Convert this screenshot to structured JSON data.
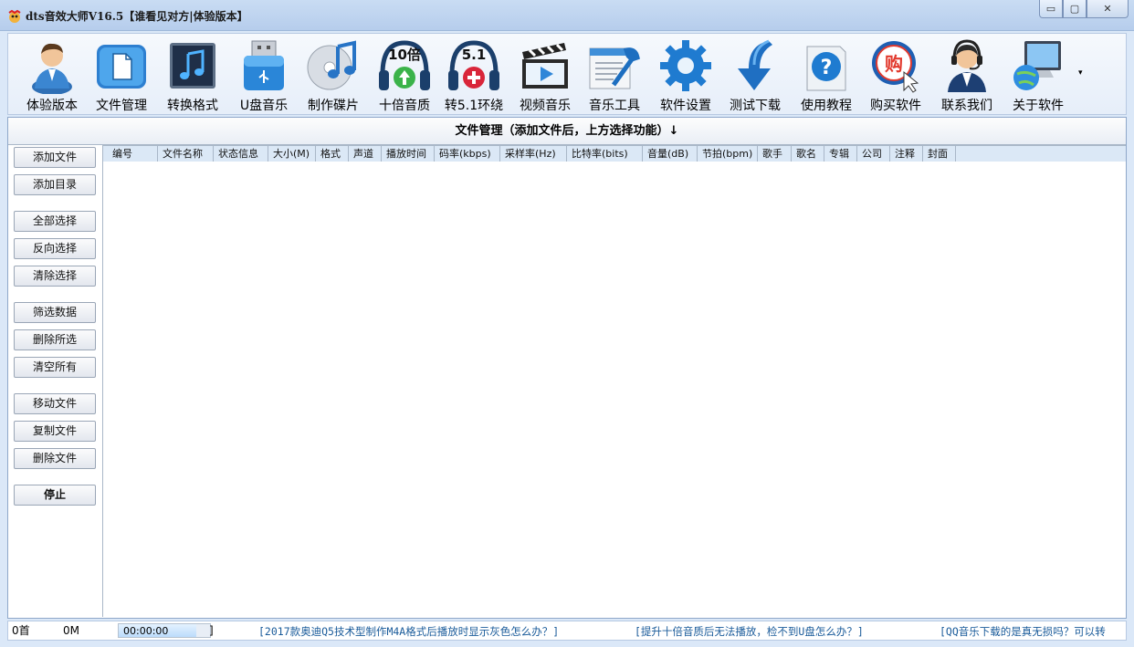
{
  "window": {
    "title": "dts音效大师V16.5【谁看见对方|体验版本】",
    "minimize": "▭",
    "maximize": "▢",
    "close": "✕"
  },
  "toolbar": {
    "items": [
      {
        "label": "体验版本",
        "icon": "user-icon"
      },
      {
        "label": "文件管理",
        "icon": "file-icon"
      },
      {
        "label": "转换格式",
        "icon": "music-note-icon"
      },
      {
        "label": "U盘音乐",
        "icon": "usb-icon"
      },
      {
        "label": "制作碟片",
        "icon": "disc-icon"
      },
      {
        "label": "十倍音质",
        "icon": "headphones-10x-icon",
        "badge": "10倍"
      },
      {
        "label": "转5.1环绕",
        "icon": "headphones-51-icon",
        "badge": "5.1"
      },
      {
        "label": "视频音乐",
        "icon": "clapper-icon"
      },
      {
        "label": "音乐工具",
        "icon": "tools-icon"
      },
      {
        "label": "软件设置",
        "icon": "gear-icon"
      },
      {
        "label": "测试下载",
        "icon": "download-arrow-icon"
      },
      {
        "label": "使用教程",
        "icon": "help-icon"
      },
      {
        "label": "购买软件",
        "icon": "buy-icon",
        "badge": "购"
      },
      {
        "label": "联系我们",
        "icon": "support-agent-icon"
      },
      {
        "label": "关于软件",
        "icon": "computer-globe-icon"
      }
    ],
    "more": "▾"
  },
  "section": {
    "title": "文件管理（添加文件后，上方选择功能）↓"
  },
  "sidebar": {
    "buttons": [
      {
        "label": "添加文件"
      },
      {
        "label": "添加目录"
      },
      {
        "label": "全部选择"
      },
      {
        "label": "反向选择"
      },
      {
        "label": "清除选择"
      },
      {
        "label": "筛选数据"
      },
      {
        "label": "删除所选"
      },
      {
        "label": "清空所有"
      },
      {
        "label": "移动文件"
      },
      {
        "label": "复制文件"
      },
      {
        "label": "删除文件"
      },
      {
        "label": "停止"
      }
    ]
  },
  "table": {
    "columns": [
      "编号",
      "文件名称",
      "状态信息",
      "大小(M)",
      "格式",
      "声道",
      "播放时间",
      "码率(kbps)",
      "采样率(Hz)",
      "比特率(bits)",
      "音量(dB)",
      "节拍(bpm)",
      "歌手",
      "歌名",
      "专辑",
      "公司",
      "注释",
      "封面"
    ],
    "rows": []
  },
  "status": {
    "count": "0首",
    "size": "0M",
    "time": "00:00:00",
    "progress": 0.85,
    "progress_end": "]",
    "tip1": "[2017款奥迪Q5技术型制作M4A格式后播放时显示灰色怎么办？]",
    "tip2": "[提升十倍音质后无法播放，检不到U盘怎么办？]",
    "tip3": "[QQ音乐下载的是真无损吗？可以转"
  },
  "colors": {
    "accent": "#1a5b9a",
    "header_bg": "#dbe8f6",
    "window_bg": "#dbe8f8"
  }
}
